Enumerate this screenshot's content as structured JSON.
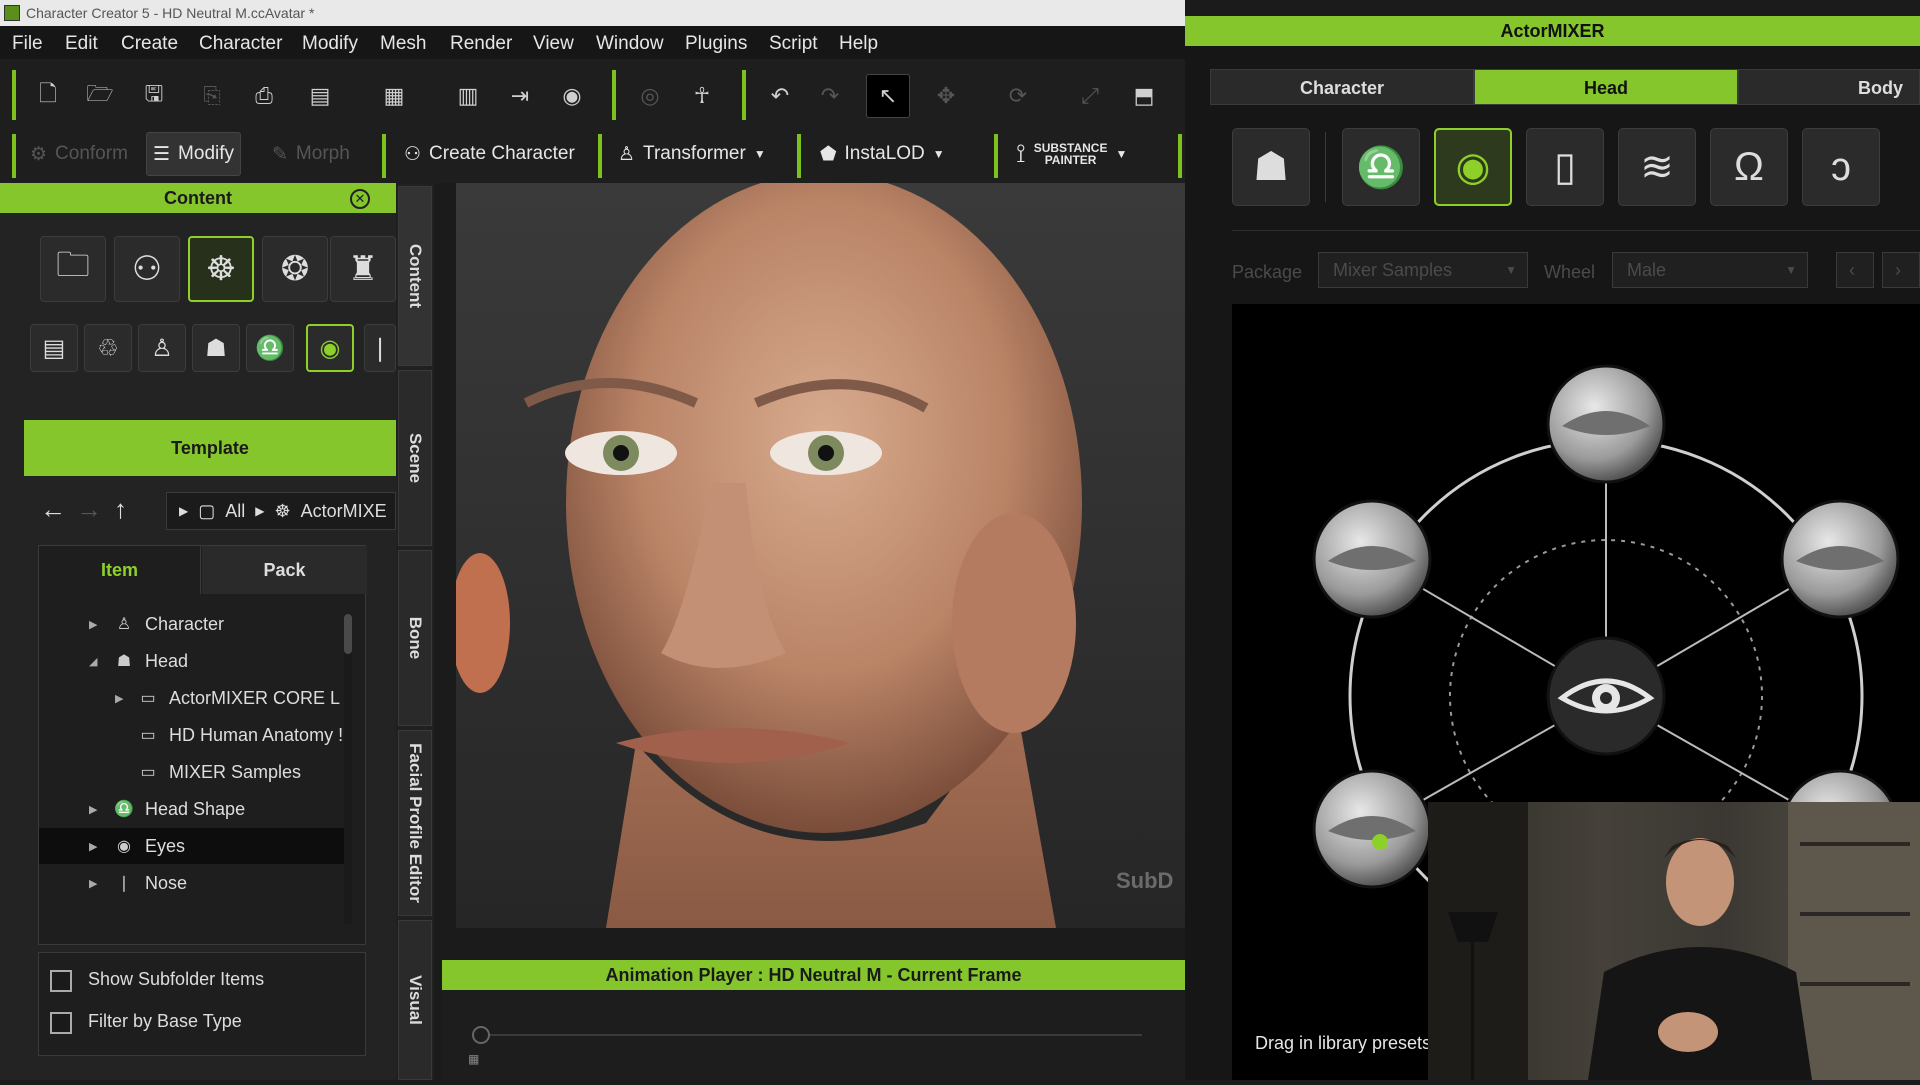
{
  "window": {
    "title": "Character Creator 5 - HD Neutral M.ccAvatar *"
  },
  "menu": [
    "File",
    "Edit",
    "Create",
    "Character",
    "Modify",
    "Mesh",
    "Render",
    "View",
    "Window",
    "Plugins",
    "Script",
    "Help"
  ],
  "toolbar2": {
    "conform": "Conform",
    "modify": "Modify",
    "morph": "Morph",
    "create_character": "Create Character",
    "transformer": "Transformer",
    "instalod": "InstaLOD",
    "substance_line1": "SUBSTANCE",
    "substance_line2": "PAINTER"
  },
  "content_panel": {
    "title": "Content",
    "template": "Template",
    "breadcrumb": {
      "all": "All",
      "current": "ActorMIXE"
    },
    "tabs": [
      "Item",
      "Pack"
    ],
    "tree": [
      {
        "label": "Character"
      },
      {
        "label": "Head"
      },
      {
        "label": "ActorMIXER CORE L"
      },
      {
        "label": "HD Human Anatomy !"
      },
      {
        "label": "MIXER Samples"
      },
      {
        "label": "Head Shape"
      },
      {
        "label": "Eyes"
      },
      {
        "label": "Nose"
      }
    ],
    "options": {
      "show_subfolder": "Show Subfolder Items",
      "filter_base": "Filter by Base Type"
    }
  },
  "side_tabs": [
    "Content",
    "Scene",
    "Bone",
    "Facial Profile Editor",
    "Visual"
  ],
  "viewport": {
    "subd_label": "SubD"
  },
  "animation_player": {
    "title": "Animation Player : HD Neutral M - Current Frame"
  },
  "actormixer": {
    "title": "ActorMIXER",
    "tabs": [
      "Character",
      "Head",
      "Body"
    ],
    "package_label": "Package",
    "package_value": "Mixer Samples",
    "wheel_label": "Wheel",
    "wheel_value": "Male",
    "drag_hint": "Drag in library presets",
    "colors": {
      "accent": "#85c62c"
    }
  }
}
